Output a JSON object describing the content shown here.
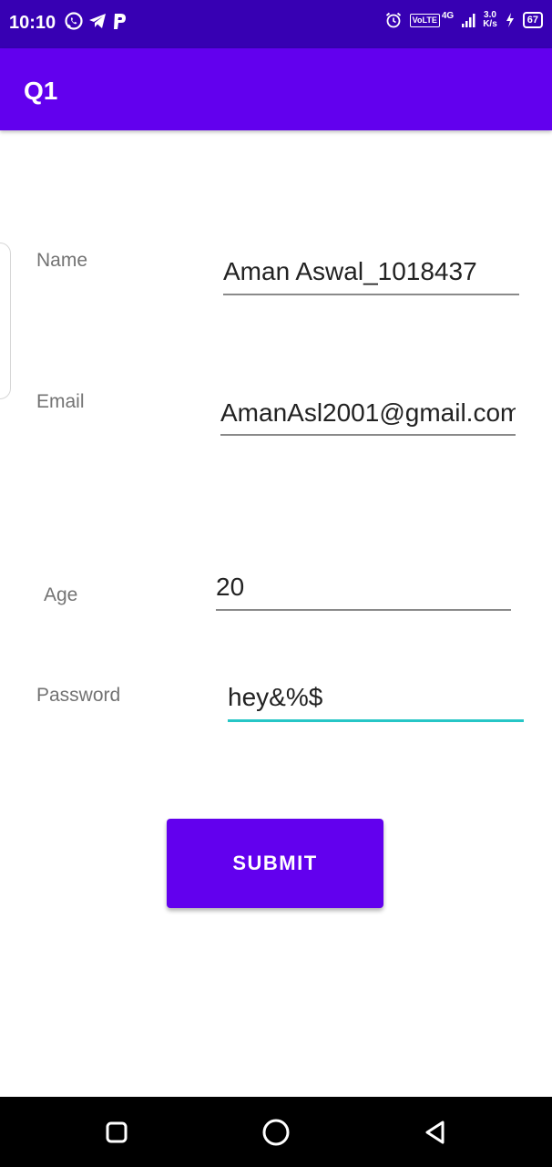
{
  "status_bar": {
    "time": "10:10",
    "left_icons": [
      "whatsapp-icon",
      "telegram-icon",
      "paytm-icon"
    ],
    "alarm_icon": "alarm-icon",
    "volte_label": "VoLTE",
    "network_label": "4G",
    "speed_value": "3.0",
    "speed_unit": "K/s",
    "battery_level": "67"
  },
  "app_bar": {
    "title": "Q1"
  },
  "form": {
    "name_label": "Name",
    "name_value": "Aman Aswal_1018437",
    "email_label": "Email",
    "email_value": "AmanAsl2001@gmail.com",
    "age_label": "Age",
    "age_value": "20",
    "password_label": "Password",
    "password_value": "hey&%$",
    "submit_label": "SUBMIT"
  },
  "colors": {
    "primary": "#6200ee",
    "primary_dark": "#3700b3",
    "accent": "#26c6c6"
  },
  "nav_bar": {
    "buttons": [
      "recents-icon",
      "home-icon",
      "back-icon"
    ]
  }
}
